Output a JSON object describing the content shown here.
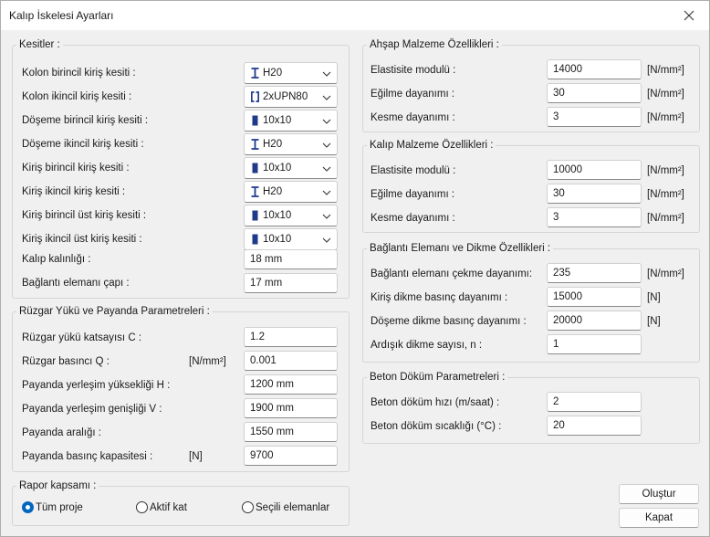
{
  "window": {
    "title": "Kalıp İskelesi Ayarları"
  },
  "kesitler": {
    "legend": "Kesitler :",
    "rows": [
      {
        "label": "Kolon birincil kiriş kesiti :",
        "value": "H20",
        "icon": "i-beam-icon"
      },
      {
        "label": "Kolon ikincil kiriş kesiti :",
        "value": "2xUPN80",
        "icon": "double-channel-icon"
      },
      {
        "label": "Döşeme birincil kiriş kesiti :",
        "value": "10x10",
        "icon": "rectangle-section-icon"
      },
      {
        "label": "Döşeme ikincil kiriş kesiti :",
        "value": "H20",
        "icon": "i-beam-icon"
      },
      {
        "label": "Kiriş birincil kiriş kesiti :",
        "value": "10x10",
        "icon": "rectangle-section-icon"
      },
      {
        "label": "Kiriş ikincil kiriş kesiti :",
        "value": "H20",
        "icon": "i-beam-icon"
      },
      {
        "label": "Kiriş birincil üst kiriş kesiti :",
        "value": "10x10",
        "icon": "rectangle-section-icon"
      },
      {
        "label": "Kiriş ikincil üst kiriş kesiti :",
        "value": "10x10",
        "icon": "rectangle-section-icon"
      }
    ],
    "kalip_kalinligi": {
      "label": "Kalıp kalınlığı :",
      "value": "18 mm"
    },
    "baglanti_capi": {
      "label": "Bağlantı elemanı çapı :",
      "value": "17 mm"
    }
  },
  "ruzgar": {
    "legend": "Rüzgar Yükü ve Payanda Parametreleri :",
    "rows": [
      {
        "label": "Rüzgar yükü katsayısı C :",
        "unit": "",
        "value": "1.2"
      },
      {
        "label": "Rüzgar basıncı Q :",
        "unit": "[N/mm²]",
        "value": "0.001"
      },
      {
        "label": "Payanda yerleşim yüksekliği H :",
        "unit": "",
        "value": "1200 mm"
      },
      {
        "label": "Payanda yerleşim genişliği V :",
        "unit": "",
        "value": "1900 mm"
      },
      {
        "label": "Payanda aralığı :",
        "unit": "",
        "value": "1550 mm"
      },
      {
        "label": "Payanda basınç kapasitesi :",
        "unit": "[N]",
        "value": "9700"
      }
    ]
  },
  "rapor": {
    "legend": "Rapor kapsamı :",
    "options": [
      "Tüm proje",
      "Aktif kat",
      "Seçili elemanlar"
    ],
    "selected": "Tüm proje"
  },
  "ahsap": {
    "legend": "Ahşap Malzeme Özellikleri :",
    "rows": [
      {
        "label": "Elastisite modulü :",
        "value": "14000",
        "unit": "[N/mm²]"
      },
      {
        "label": "Eğilme dayanımı :",
        "value": "30",
        "unit": "[N/mm²]"
      },
      {
        "label": "Kesme dayanımı :",
        "value": "3",
        "unit": "[N/mm²]"
      }
    ]
  },
  "kalip": {
    "legend": "Kalıp Malzeme Özellikleri :",
    "rows": [
      {
        "label": "Elastisite modulü :",
        "value": "10000",
        "unit": "[N/mm²]"
      },
      {
        "label": "Eğilme dayanımı :",
        "value": "30",
        "unit": "[N/mm²]"
      },
      {
        "label": "Kesme dayanımı :",
        "value": "3",
        "unit": "[N/mm²]"
      }
    ]
  },
  "baglanti": {
    "legend": "Bağlantı Elemanı ve Dikme Özellikleri :",
    "rows": [
      {
        "label": "Bağlantı elemanı çekme dayanımı:",
        "value": "235",
        "unit": "[N/mm²]"
      },
      {
        "label": "Kiriş dikme basınç dayanımı :",
        "value": "15000",
        "unit": "[N]"
      },
      {
        "label": "Döşeme dikme basınç dayanımı :",
        "value": "20000",
        "unit": "[N]"
      },
      {
        "label": "Ardışık dikme sayısı, n :",
        "value": "1",
        "unit": ""
      }
    ]
  },
  "beton": {
    "legend": "Beton Döküm Parametreleri :",
    "rows": [
      {
        "label": "Beton döküm hızı (m/saat) :",
        "value": "2"
      },
      {
        "label": "Beton döküm sıcaklığı (°C) :",
        "value": "20"
      }
    ]
  },
  "buttons": {
    "create": "Oluştur",
    "close": "Kapat"
  },
  "colors": {
    "accent": "#0067c0",
    "section_icon": "#1f3a8a"
  }
}
